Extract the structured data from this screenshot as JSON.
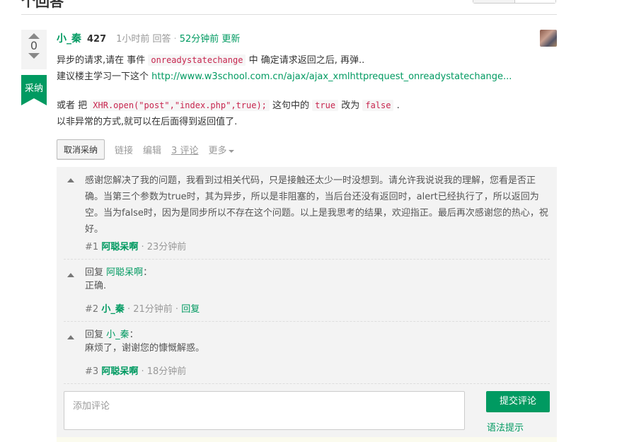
{
  "page": {
    "section_title": "个回答"
  },
  "answer": {
    "votes": "0",
    "accepted_label": "采纳",
    "author": "小_秦",
    "reputation": "427",
    "answered_time": "1小时前 回答",
    "updated_time": "52分钟前 更新",
    "body": {
      "line1_pre": "异步的请求,请在 事件 ",
      "line1_code": "onreadystatechange",
      "line1_post": " 中 确定请求返回之后, 再弹..",
      "line2_pre": "建议楼主学习一下这个 ",
      "line2_link": "http://www.w3school.com.cn/ajax/ajax_xmlhttprequest_onreadystatechange...",
      "line3_pre": "或者 把 ",
      "line3_code1": "XHR.open(\"post\",\"index.php\",true);",
      "line3_mid1": " 这句中的 ",
      "line3_code2": "true",
      "line3_mid2": " 改为 ",
      "line3_code3": "false",
      "line3_post": " .",
      "line4": "以非异常的方式,就可以在后面得到返回值了."
    },
    "actions": {
      "cancel_accept": "取消采纳",
      "link": "链接",
      "edit": "编辑",
      "comments": "3 评论",
      "more": "更多"
    }
  },
  "comments": [
    {
      "text": "感谢您解决了我的问题，我看到过相关代码，只是接触还太少一时没想到。请允许我说说我的理解，您看是否正确。当第三个参数为true时，其为异步，所以是非阻塞的，当后台还没有返回时，alert已经执行了，所以返回为空。当为false时，因为是同步所以不存在这个问题。以上是我思考的结果，欢迎指正。最后再次感谢您的热心，祝好。",
      "num": "#1",
      "user": "阿聪呆啊",
      "time": "· 23分钟前"
    },
    {
      "reply_prefix": "回复",
      "reply_to": "阿聪呆啊",
      "reply_colon": "：",
      "text": "正确.",
      "num": "#2",
      "user": "小_秦",
      "time": "· 21分钟前 ·",
      "reply_link": "回复"
    },
    {
      "reply_prefix": "回复",
      "reply_to": "小_秦",
      "reply_colon": "：",
      "text": "麻烦了，谢谢您的慷慨解惑。",
      "num": "#3",
      "user": "阿聪呆啊",
      "time": "· 18分钟前"
    }
  ],
  "comment_form": {
    "placeholder": "添加评论",
    "submit": "提交评论",
    "syntax_help": "语法提示"
  }
}
